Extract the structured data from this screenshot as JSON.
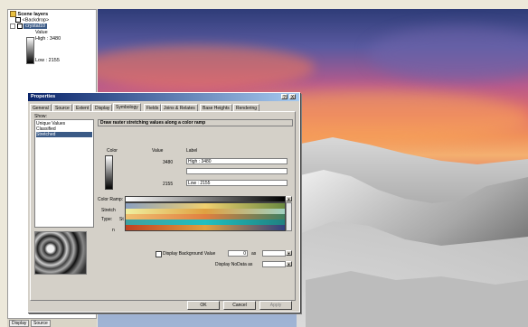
{
  "toc": {
    "root": "Scene layers",
    "items": [
      {
        "label": "<Backdrop>"
      },
      {
        "label": "crystal10"
      }
    ],
    "legend_title": "Value",
    "legend_high": "High : 3480",
    "legend_low": "Low : 2155",
    "tabs": [
      "Display",
      "Source"
    ]
  },
  "dialog": {
    "title": "Properties",
    "title_buttons": [
      "?",
      "X"
    ],
    "tabs": [
      "General",
      "Source",
      "Extent",
      "Display",
      "Symbology",
      "Fields",
      "Joins & Relates",
      "Base Heights",
      "Rendering"
    ],
    "active_tab": "Symbology",
    "show_label": "Show:",
    "show_options": [
      "Unique Values",
      "Classified",
      "Stretched"
    ],
    "selected_show": "Stretched",
    "description": "Draw raster stretching values along a color ramp",
    "color_col": "Color",
    "value_col": "Value",
    "label_col": "Label",
    "high_value": "3480",
    "high_label": "High : 3480",
    "low_value": "2155",
    "low_label": "Low : 2155",
    "color_ramp_label": "Color Ramp:",
    "stretch_label": "Stretch",
    "type_label": "Type:",
    "type_value": "St",
    "n_label": "n",
    "display_bg_label": "Display Background Value",
    "bg_value": "0",
    "as_label": "as",
    "nodata_label": "Display NoData as",
    "ok_label": "OK",
    "cancel_label": "Cancel",
    "apply_label": "Apply"
  },
  "colors": {
    "selection": "#3a5a86",
    "title_bar": "#0a246a",
    "dialog_bg": "#d4d0c8"
  }
}
